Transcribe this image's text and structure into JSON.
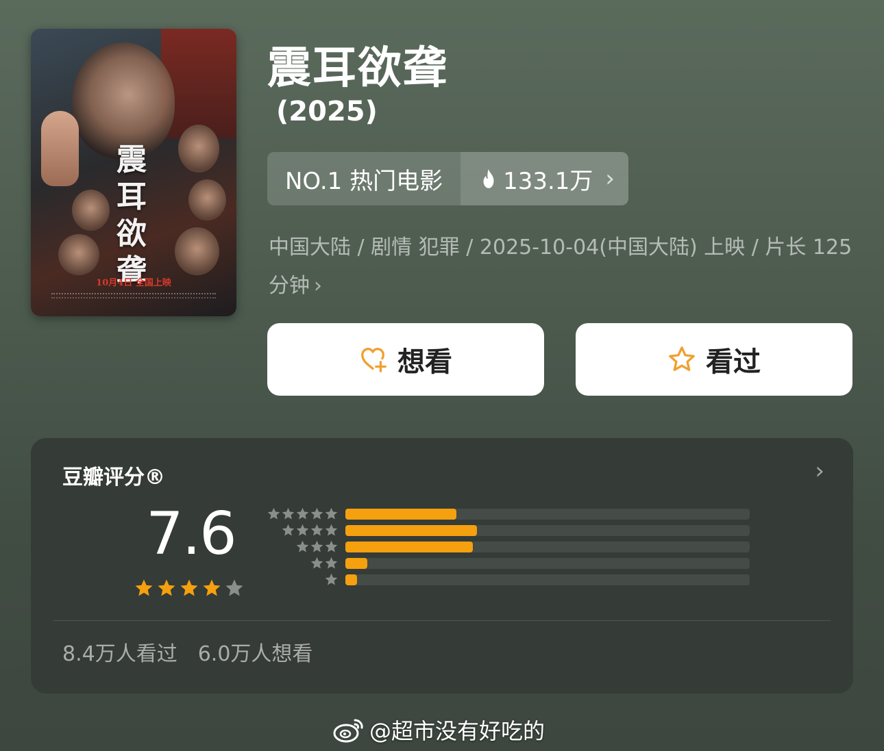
{
  "poster": {
    "title_chars": "震耳欲聋",
    "release_note": "10月4日 全国上映"
  },
  "movie": {
    "title": "震耳欲聋",
    "year": "(2025)"
  },
  "rank_badge": {
    "label": "NO.1 热门电影",
    "heat": "133.1万"
  },
  "meta": {
    "line": "中国大陆 / 剧情 犯罪 / 2025-10-04(中国大陆) 上映 / 片长 125 分钟"
  },
  "actions": {
    "want_label": "想看",
    "seen_label": "看过"
  },
  "rating": {
    "label": "豆瓣评分®",
    "score": "7.6",
    "stars_filled": 4,
    "stars_total": 5,
    "distribution_fraction": [
      0.275,
      0.325,
      0.315,
      0.055,
      0.028
    ],
    "watched_text": "8.4万人看过",
    "want_text": "6.0万人想看"
  },
  "colors": {
    "accent_orange": "#f5a00e",
    "icon_orange": "#f0a030",
    "card_bg": "#353b37"
  },
  "watermark": {
    "text": "@超市没有好吃的"
  }
}
